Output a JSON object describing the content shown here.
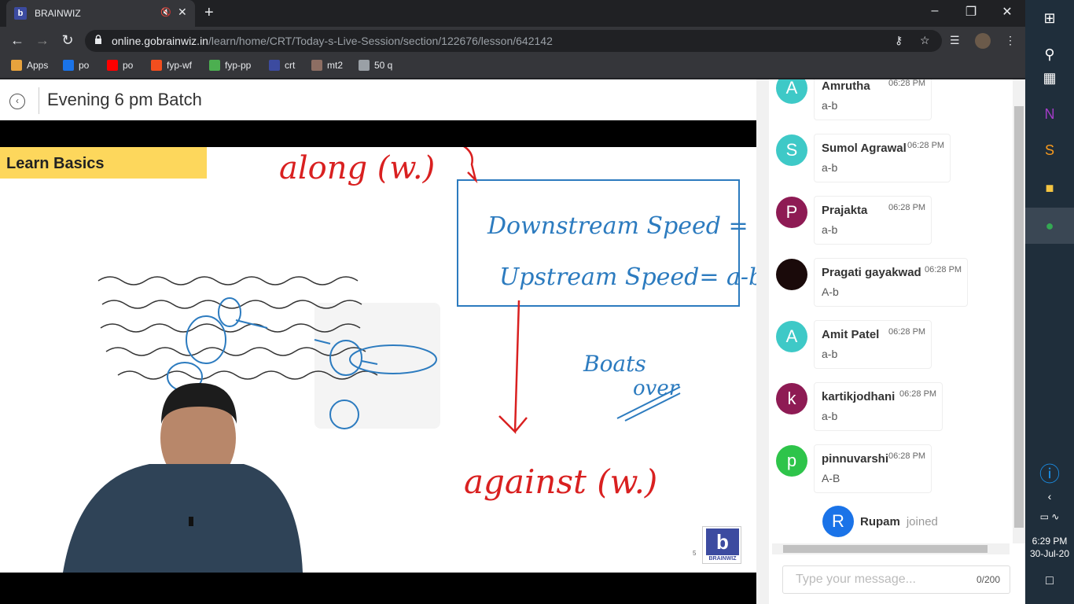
{
  "browser": {
    "tab_title": "BRAINWIZ",
    "url_domain": "online.gobrainwiz.in",
    "url_path": "/learn/home/CRT/Today-s-Live-Session/section/122676/lesson/642142",
    "bookmarks": [
      {
        "label": "Apps",
        "icon": "apps-grid-icon",
        "color": "#e8a33d"
      },
      {
        "label": "po",
        "icon": "ie-icon",
        "color": "#1a73e8"
      },
      {
        "label": "po",
        "icon": "youtube-icon",
        "color": "#ff0000"
      },
      {
        "label": "fyp-wf",
        "icon": "figma-icon",
        "color": "#f24e1e"
      },
      {
        "label": "fyp-pp",
        "icon": "chart-icon",
        "color": "#4caf50"
      },
      {
        "label": "crt",
        "icon": "brainwiz-icon",
        "color": "#3c4ba0"
      },
      {
        "label": "mt2",
        "icon": "cc-icon",
        "color": "#8d6e63"
      },
      {
        "label": "50 q",
        "icon": "globe-icon",
        "color": "#9aa0a6"
      }
    ]
  },
  "header": {
    "title": "Evening 6 pm Batch"
  },
  "slide": {
    "heading": "Learn Basics",
    "page_number": "5",
    "brand": "BRAINWIZ",
    "ink": {
      "along": "along (w.)",
      "downstream": "Downstream Speed = a+b",
      "upstream": "Upstream Speed= a-b",
      "against": "against (w.)",
      "boats": "Boats",
      "over": "over"
    }
  },
  "chat": {
    "messages": [
      {
        "initial": "A",
        "name": "Amrutha",
        "time": "06:28 PM",
        "text": "a-b",
        "color": "#3ec9c7"
      },
      {
        "initial": "S",
        "name": "Sumol Agrawal",
        "time": "06:28 PM",
        "text": "a-b",
        "color": "#3ec9c7"
      },
      {
        "initial": "P",
        "name": "Prajakta",
        "time": "06:28 PM",
        "text": "a-b",
        "color": "#8e1b54"
      },
      {
        "initial": "",
        "name": "Pragati gayakwad",
        "time": "06:28 PM",
        "text": "A-b",
        "color": "#1a0a0a"
      },
      {
        "initial": "A",
        "name": "Amit Patel",
        "time": "06:28 PM",
        "text": "a-b",
        "color": "#3ec9c7"
      },
      {
        "initial": "k",
        "name": "kartikjodhani",
        "time": "06:28 PM",
        "text": "a-b",
        "color": "#8e1b54"
      },
      {
        "initial": "p",
        "name": "pinnuvarshi",
        "time": "06:28 PM",
        "text": "A-B",
        "color": "#2ec44a"
      }
    ],
    "joined": {
      "initial": "R",
      "name": "Rupam",
      "status": "joined"
    },
    "input_placeholder": "Type your message...",
    "char_count": "0/200"
  },
  "taskbar": {
    "time": "6:29 PM",
    "date": "30-Jul-20"
  }
}
